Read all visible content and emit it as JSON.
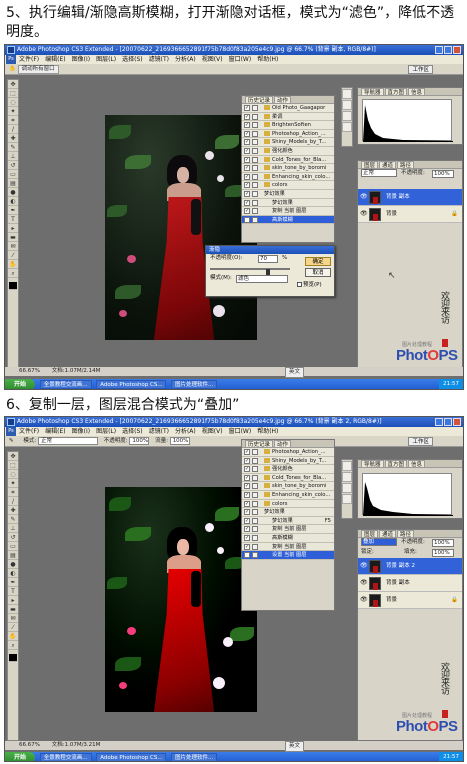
{
  "step1": {
    "caption": "5、执行编辑/渐隐高斯模糊，打开渐隐对话框，模式为“滤色”，降低不透明度。",
    "window_title": "Adobe Photoshop CS3 Extended - [20070622_2169366652891f75b78d0f83a205e4c9.jpg @ 66.7% (背景 副本, RGB/8#)]",
    "menus": [
      "文件(F)",
      "编辑(E)",
      "图像(I)",
      "图层(L)",
      "选择(S)",
      "滤镜(T)",
      "分析(A)",
      "视图(V)",
      "窗口(W)",
      "帮助(H)"
    ],
    "options_bar": {
      "button": "调动所有窗口",
      "workspace": "工作区"
    },
    "history_tabs": [
      "历史记录",
      "动作"
    ],
    "history_items": [
      "Old Photo_Gaagapor",
      "柔调",
      "BrightenSoften",
      "Photoshop_Action_...",
      "Shiny_Models_by_T...",
      "强化颜色",
      "Cold_Tones_for_Bla...",
      "skin_tone_by_boromi",
      "Enhancing_skin_colo...",
      "colors",
      "梦幻效果",
      "梦幻效果",
      "复制 当前 图层",
      "高斯模糊"
    ],
    "dialog": {
      "title": "渐隐",
      "opacity_label": "不透明度(O):",
      "opacity_value": "70",
      "opacity_unit": "%",
      "mode_label": "模式(M):",
      "mode_value": "滤色",
      "ok": "确定",
      "cancel": "取消",
      "preview": "预览(P)"
    },
    "nav_tabs": [
      "导航器",
      "直方图",
      "信息"
    ],
    "layers_tabs": [
      "图层",
      "通道",
      "路径"
    ],
    "layer_mode": "正常",
    "layer_opacity_label": "不透明度:",
    "layer_opacity": "100%",
    "layers": [
      "背景 副本",
      "背景"
    ],
    "status": {
      "zoom": "66.67%",
      "doc": "文档:1.07M/2.14M"
    },
    "ime": "英文",
    "taskbar": {
      "start": "开始",
      "tasks": [
        "全景教程交流画...",
        "Adobe Photoshop CS...",
        "图片处理软件..."
      ],
      "clock": "21:57"
    }
  },
  "step2": {
    "caption": "6、复制一层，图层混合模式为“叠加”",
    "window_title": "Adobe Photoshop CS3 Extended - [20070622_2169366652891f75b78d0f83a205e4c9.jpg @ 66.7% (背景 副本 2, RGB/8#)]",
    "menus": [
      "文件(F)",
      "编辑(E)",
      "图像(I)",
      "图层(L)",
      "选择(S)",
      "滤镜(T)",
      "分析(A)",
      "视图(V)",
      "窗口(W)",
      "帮助(H)"
    ],
    "options_bar": {
      "mode_label": "模式:",
      "mode_value": "正常",
      "opacity_label": "不透明度:",
      "opacity_value": "100%",
      "flow_label": "流量:",
      "flow_value": "100%",
      "workspace": "工作区"
    },
    "history_tabs": [
      "历史记录",
      "动作"
    ],
    "history_items": [
      "Photoshop_Action_...",
      "Shiny_Models_by_T...",
      "强化颜色",
      "Cold_Tones_for_Bla...",
      "skin_tone_by_boromi",
      "Enhancing_skin_colo...",
      "colors",
      "梦幻效果",
      "梦幻效果",
      "复制 当前 图层",
      "高斯模糊",
      "复制 当前 图层",
      "设置 当前 图层"
    ],
    "history_shortcut": "F5",
    "nav_tabs": [
      "导航器",
      "直方图",
      "信息"
    ],
    "layers_tabs": [
      "图层",
      "通道",
      "路径"
    ],
    "layer_mode": "叠加",
    "layer_opacity_label": "不透明度:",
    "layer_opacity": "100%",
    "fill_label": "填充:",
    "fill_value": "100%",
    "lock_label": "锁定:",
    "layers": [
      "背景 副本 2",
      "背景 副本",
      "背景"
    ],
    "status": {
      "zoom": "66.67%",
      "doc": "文档:1.07M/3.21M"
    },
    "ime": "英文",
    "taskbar": {
      "start": "开始",
      "tasks": [
        "全景教程交流画...",
        "Adobe Photoshop CS...",
        "图片处理软件..."
      ],
      "clock": "21:57"
    }
  },
  "logo": {
    "photo": "Phot",
    "o": "O",
    "ps": "PS",
    "sub": "图片处理教程",
    "signature": "欢迎来访"
  }
}
